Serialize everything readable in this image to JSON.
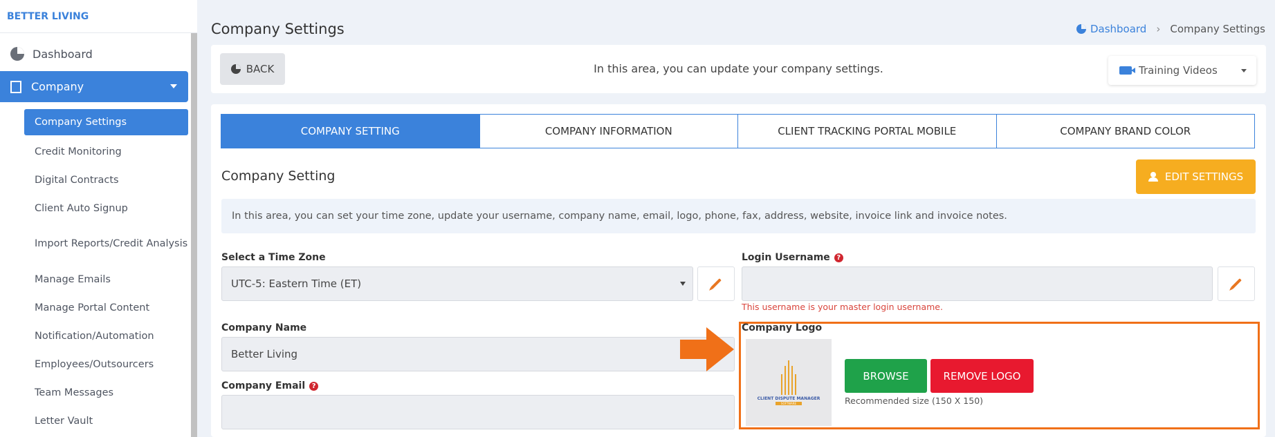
{
  "brand": "BETTER LIVING",
  "sidebar": {
    "dashboard": "Dashboard",
    "company": "Company",
    "items": [
      "Company Settings",
      "Credit Monitoring",
      "Digital Contracts",
      "Client Auto Signup",
      "Import Reports/Credit Analysis",
      "Manage Emails",
      "Manage Portal Content",
      "Notification/Automation",
      "Employees/Outsourcers",
      "Team Messages",
      "Letter Vault"
    ]
  },
  "header": {
    "title": "Company Settings",
    "breadcrumb_home": "Dashboard",
    "breadcrumb_current": "Company Settings"
  },
  "top_bar": {
    "back": "BACK",
    "info": "In this area, you can update your company settings.",
    "training": "Training Videos"
  },
  "tabs": [
    "COMPANY SETTING",
    "COMPANY INFORMATION",
    "CLIENT TRACKING PORTAL MOBILE",
    "COMPANY BRAND COLOR"
  ],
  "section": {
    "title": "Company Setting",
    "edit_button": "EDIT SETTINGS",
    "info": "In this area, you can set your time zone, update your username, company name, email, logo, phone, fax, address, website, invoice link and invoice notes."
  },
  "form": {
    "timezone_label": "Select a Time Zone",
    "timezone_value": "UTC-5: Eastern Time (ET)",
    "username_label": "Login Username",
    "username_value": "",
    "username_error": "This username is your master login username.",
    "company_name_label": "Company Name",
    "company_name_value": "Better Living",
    "company_email_label": "Company Email",
    "company_email_value": "",
    "logo_label": "Company Logo",
    "logo_text": "CLIENT DISPUTE MANAGER",
    "logo_subtext": "SOFTWARE",
    "browse": "BROWSE",
    "remove_logo": "REMOVE LOGO",
    "recommended": "Recommended size (150 X 150)"
  },
  "colors": {
    "primary": "#3b82db",
    "warning": "#f6ad20",
    "success": "#1fa24a",
    "danger": "#e8192f",
    "highlight": "#f07018"
  }
}
